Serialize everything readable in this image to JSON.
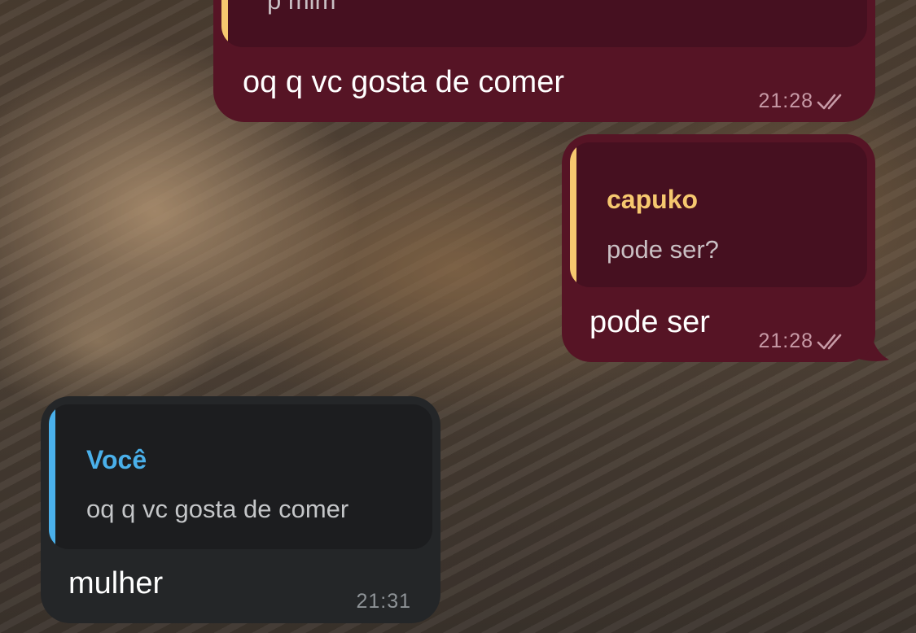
{
  "messages": [
    {
      "direction": "outgoing",
      "reply": {
        "author": "",
        "text": "p mim"
      },
      "text": "oq q vc gosta de comer",
      "time": "21:28",
      "status_icon": "double-check-icon"
    },
    {
      "direction": "outgoing",
      "reply": {
        "author": "capuko",
        "text": "pode ser?"
      },
      "text": "pode ser",
      "time": "21:28",
      "status_icon": "double-check-icon"
    },
    {
      "direction": "incoming",
      "reply": {
        "author": "Você",
        "text": "oq q vc gosta de comer"
      },
      "text": "mulher",
      "time": "21:31"
    }
  ],
  "colors": {
    "outgoing_bubble": "#561425",
    "incoming_bubble": "#242628",
    "reply_accent_outgoing": "#f6c86f",
    "reply_accent_incoming": "#4ab0ea"
  }
}
